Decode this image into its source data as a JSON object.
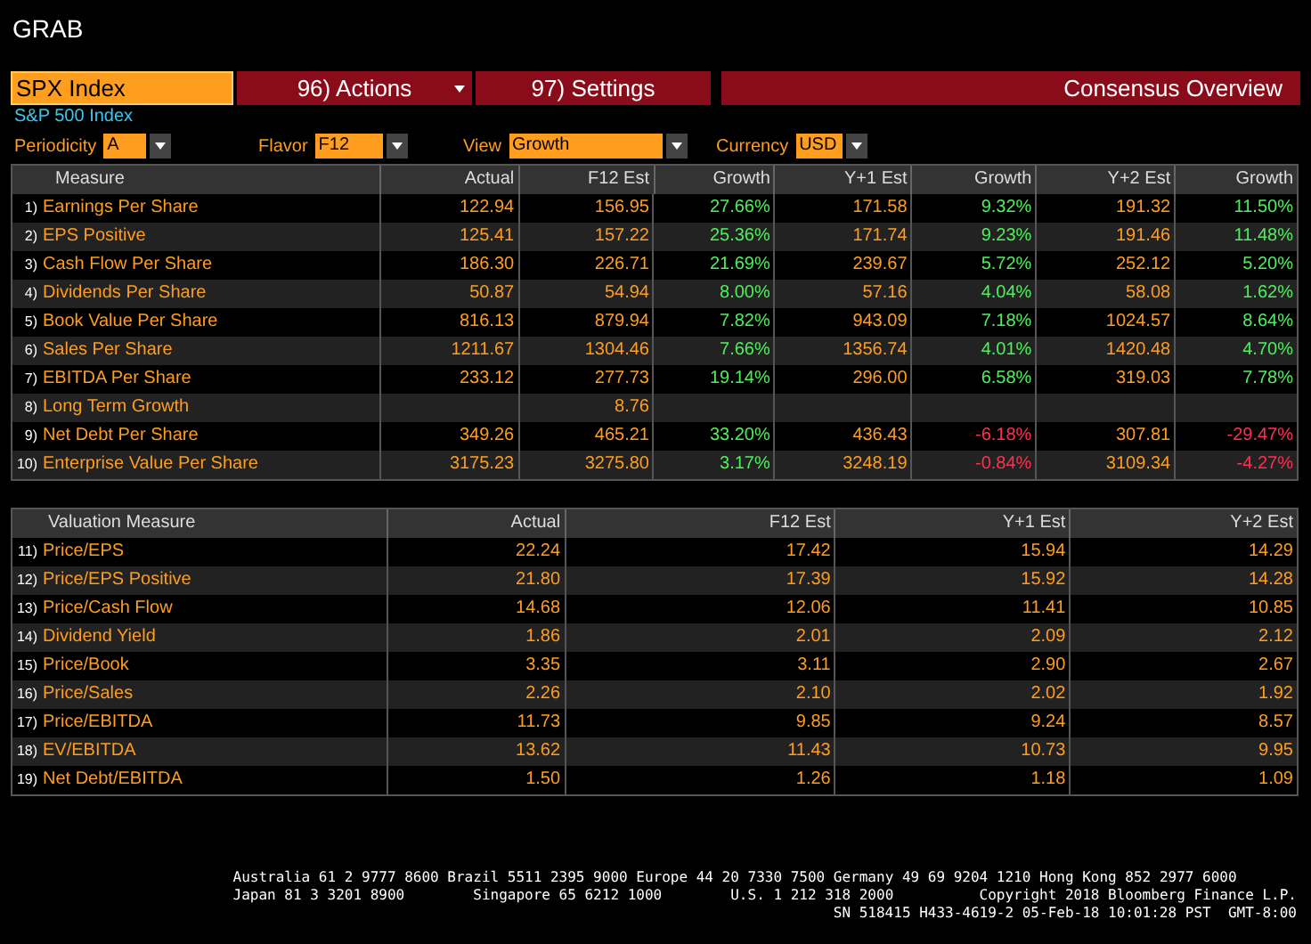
{
  "window": {
    "title": "GRAB"
  },
  "toolbar": {
    "security": "SPX Index",
    "actions": {
      "number": "96)",
      "label": "Actions"
    },
    "settings": {
      "number": "97)",
      "label": "Settings"
    },
    "title": "Consensus Overview"
  },
  "subtitle": "S&P 500 Index",
  "filters": [
    {
      "label": "Periodicity",
      "value": "A"
    },
    {
      "label": "Flavor",
      "value": "F12"
    },
    {
      "label": "View",
      "value": "Growth"
    },
    {
      "label": "Currency",
      "value": "USD"
    }
  ],
  "growth_table": {
    "columns": [
      "Measure",
      "Actual",
      "F12 Est",
      "Growth",
      "Y+1 Est",
      "Growth",
      "Y+2 Est",
      "Growth"
    ],
    "rows": [
      {
        "cells": [
          {
            "kind": "measure",
            "number": "1)",
            "text": "Earnings Per Share"
          },
          {
            "kind": "value",
            "text": "122.94"
          },
          {
            "kind": "value",
            "text": "156.95"
          },
          {
            "kind": "growth",
            "text": "27.66%",
            "color": "#4cf05a"
          },
          {
            "kind": "value",
            "text": "171.58"
          },
          {
            "kind": "growth",
            "text": "9.32%",
            "color": "#4cf05a"
          },
          {
            "kind": "value",
            "text": "191.32"
          },
          {
            "kind": "growth",
            "text": "11.50%",
            "color": "#4cf05a"
          }
        ]
      },
      {
        "cells": [
          {
            "kind": "measure",
            "number": "2)",
            "text": "EPS Positive"
          },
          {
            "kind": "value",
            "text": "125.41"
          },
          {
            "kind": "value",
            "text": "157.22"
          },
          {
            "kind": "growth",
            "text": "25.36%",
            "color": "#4cf05a"
          },
          {
            "kind": "value",
            "text": "171.74"
          },
          {
            "kind": "growth",
            "text": "9.23%",
            "color": "#4cf05a"
          },
          {
            "kind": "value",
            "text": "191.46"
          },
          {
            "kind": "growth",
            "text": "11.48%",
            "color": "#4cf05a"
          }
        ]
      },
      {
        "cells": [
          {
            "kind": "measure",
            "number": "3)",
            "text": "Cash Flow Per Share"
          },
          {
            "kind": "value",
            "text": "186.30"
          },
          {
            "kind": "value",
            "text": "226.71"
          },
          {
            "kind": "growth",
            "text": "21.69%",
            "color": "#4cf05a"
          },
          {
            "kind": "value",
            "text": "239.67"
          },
          {
            "kind": "growth",
            "text": "5.72%",
            "color": "#4cf05a"
          },
          {
            "kind": "value",
            "text": "252.12"
          },
          {
            "kind": "growth",
            "text": "5.20%",
            "color": "#4cf05a"
          }
        ]
      },
      {
        "cells": [
          {
            "kind": "measure",
            "number": "4)",
            "text": "Dividends Per Share"
          },
          {
            "kind": "value",
            "text": "50.87"
          },
          {
            "kind": "value",
            "text": "54.94"
          },
          {
            "kind": "growth",
            "text": "8.00%",
            "color": "#4cf05a"
          },
          {
            "kind": "value",
            "text": "57.16"
          },
          {
            "kind": "growth",
            "text": "4.04%",
            "color": "#4cf05a"
          },
          {
            "kind": "value",
            "text": "58.08"
          },
          {
            "kind": "growth",
            "text": "1.62%",
            "color": "#4cf05a"
          }
        ]
      },
      {
        "cells": [
          {
            "kind": "measure",
            "number": "5)",
            "text": "Book Value Per Share"
          },
          {
            "kind": "value",
            "text": "816.13"
          },
          {
            "kind": "value",
            "text": "879.94"
          },
          {
            "kind": "growth",
            "text": "7.82%",
            "color": "#4cf05a"
          },
          {
            "kind": "value",
            "text": "943.09"
          },
          {
            "kind": "growth",
            "text": "7.18%",
            "color": "#4cf05a"
          },
          {
            "kind": "value",
            "text": "1024.57"
          },
          {
            "kind": "growth",
            "text": "8.64%",
            "color": "#4cf05a"
          }
        ]
      },
      {
        "cells": [
          {
            "kind": "measure",
            "number": "6)",
            "text": "Sales Per Share"
          },
          {
            "kind": "value",
            "text": "1211.67"
          },
          {
            "kind": "value",
            "text": "1304.46"
          },
          {
            "kind": "growth",
            "text": "7.66%",
            "color": "#4cf05a"
          },
          {
            "kind": "value",
            "text": "1356.74"
          },
          {
            "kind": "growth",
            "text": "4.01%",
            "color": "#4cf05a"
          },
          {
            "kind": "value",
            "text": "1420.48"
          },
          {
            "kind": "growth",
            "text": "4.70%",
            "color": "#4cf05a"
          }
        ]
      },
      {
        "cells": [
          {
            "kind": "measure",
            "number": "7)",
            "text": "EBITDA Per Share"
          },
          {
            "kind": "value",
            "text": "233.12"
          },
          {
            "kind": "value",
            "text": "277.73"
          },
          {
            "kind": "growth",
            "text": "19.14%",
            "color": "#4cf05a"
          },
          {
            "kind": "value",
            "text": "296.00"
          },
          {
            "kind": "growth",
            "text": "6.58%",
            "color": "#4cf05a"
          },
          {
            "kind": "value",
            "text": "319.03"
          },
          {
            "kind": "growth",
            "text": "7.78%",
            "color": "#4cf05a"
          }
        ]
      },
      {
        "cells": [
          {
            "kind": "measure",
            "number": "8)",
            "text": "Long Term Growth"
          },
          {
            "kind": "empty"
          },
          {
            "kind": "value",
            "text": "8.76"
          },
          {
            "kind": "empty"
          },
          {
            "kind": "empty"
          },
          {
            "kind": "empty"
          },
          {
            "kind": "empty"
          },
          {
            "kind": "empty"
          }
        ]
      },
      {
        "cells": [
          {
            "kind": "measure",
            "number": "9)",
            "text": "Net Debt Per Share"
          },
          {
            "kind": "value",
            "text": "349.26"
          },
          {
            "kind": "value",
            "text": "465.21"
          },
          {
            "kind": "growth",
            "text": "33.20%",
            "color": "#4cf05a"
          },
          {
            "kind": "value",
            "text": "436.43"
          },
          {
            "kind": "growth",
            "text": "-6.18%",
            "color": "#ff3050"
          },
          {
            "kind": "value",
            "text": "307.81"
          },
          {
            "kind": "growth",
            "text": "-29.47%",
            "color": "#ff3050"
          }
        ]
      },
      {
        "cells": [
          {
            "kind": "measure",
            "number": "10)",
            "text": "Enterprise Value Per Share"
          },
          {
            "kind": "value",
            "text": "3175.23"
          },
          {
            "kind": "value",
            "text": "3275.80"
          },
          {
            "kind": "growth",
            "text": "3.17%",
            "color": "#4cf05a"
          },
          {
            "kind": "value",
            "text": "3248.19"
          },
          {
            "kind": "growth",
            "text": "-0.84%",
            "color": "#ff3050"
          },
          {
            "kind": "value",
            "text": "3109.34"
          },
          {
            "kind": "growth",
            "text": "-4.27%",
            "color": "#ff3050"
          }
        ]
      }
    ]
  },
  "valuation_table": {
    "columns": [
      "Valuation Measure",
      "Actual",
      "F12 Est",
      "Y+1 Est",
      "Y+2 Est"
    ],
    "rows": [
      {
        "cells": [
          {
            "kind": "measure",
            "number": "11)",
            "text": "Price/EPS"
          },
          {
            "kind": "value",
            "text": "22.24"
          },
          {
            "kind": "value",
            "text": "17.42"
          },
          {
            "kind": "value",
            "text": "15.94"
          },
          {
            "kind": "value",
            "text": "14.29"
          }
        ]
      },
      {
        "cells": [
          {
            "kind": "measure",
            "number": "12)",
            "text": "Price/EPS Positive"
          },
          {
            "kind": "value",
            "text": "21.80"
          },
          {
            "kind": "value",
            "text": "17.39"
          },
          {
            "kind": "value",
            "text": "15.92"
          },
          {
            "kind": "value",
            "text": "14.28"
          }
        ]
      },
      {
        "cells": [
          {
            "kind": "measure",
            "number": "13)",
            "text": "Price/Cash Flow"
          },
          {
            "kind": "value",
            "text": "14.68"
          },
          {
            "kind": "value",
            "text": "12.06"
          },
          {
            "kind": "value",
            "text": "11.41"
          },
          {
            "kind": "value",
            "text": "10.85"
          }
        ]
      },
      {
        "cells": [
          {
            "kind": "measure",
            "number": "14)",
            "text": "Dividend Yield"
          },
          {
            "kind": "value",
            "text": "1.86"
          },
          {
            "kind": "value",
            "text": "2.01"
          },
          {
            "kind": "value",
            "text": "2.09"
          },
          {
            "kind": "value",
            "text": "2.12"
          }
        ]
      },
      {
        "cells": [
          {
            "kind": "measure",
            "number": "15)",
            "text": "Price/Book"
          },
          {
            "kind": "value",
            "text": "3.35"
          },
          {
            "kind": "value",
            "text": "3.11"
          },
          {
            "kind": "value",
            "text": "2.90"
          },
          {
            "kind": "value",
            "text": "2.67"
          }
        ]
      },
      {
        "cells": [
          {
            "kind": "measure",
            "number": "16)",
            "text": "Price/Sales"
          },
          {
            "kind": "value",
            "text": "2.26"
          },
          {
            "kind": "value",
            "text": "2.10"
          },
          {
            "kind": "value",
            "text": "2.02"
          },
          {
            "kind": "value",
            "text": "1.92"
          }
        ]
      },
      {
        "cells": [
          {
            "kind": "measure",
            "number": "17)",
            "text": "Price/EBITDA"
          },
          {
            "kind": "value",
            "text": "11.73"
          },
          {
            "kind": "value",
            "text": "9.85"
          },
          {
            "kind": "value",
            "text": "9.24"
          },
          {
            "kind": "value",
            "text": "8.57"
          }
        ]
      },
      {
        "cells": [
          {
            "kind": "measure",
            "number": "18)",
            "text": "EV/EBITDA"
          },
          {
            "kind": "value",
            "text": "13.62"
          },
          {
            "kind": "value",
            "text": "11.43"
          },
          {
            "kind": "value",
            "text": "10.73"
          },
          {
            "kind": "value",
            "text": "9.95"
          }
        ]
      },
      {
        "cells": [
          {
            "kind": "measure",
            "number": "19)",
            "text": "Net Debt/EBITDA"
          },
          {
            "kind": "value",
            "text": "1.50"
          },
          {
            "kind": "value",
            "text": "1.26"
          },
          {
            "kind": "value",
            "text": "1.18"
          },
          {
            "kind": "value",
            "text": "1.09"
          }
        ]
      }
    ]
  },
  "footer": {
    "lines": [
      "Australia 61 2 9777 8600 Brazil 5511 2395 9000 Europe 44 20 7330 7500 Germany 49 69 9204 1210 Hong Kong 852 2977 6000",
      "Japan 81 3 3201 8900        Singapore 65 6212 1000        U.S. 1 212 318 2000          Copyright 2018 Bloomberg Finance L.P.",
      "SN 518415 H433-4619-2 05-Feb-18 10:01:28 PST  GMT-8:00"
    ]
  }
}
